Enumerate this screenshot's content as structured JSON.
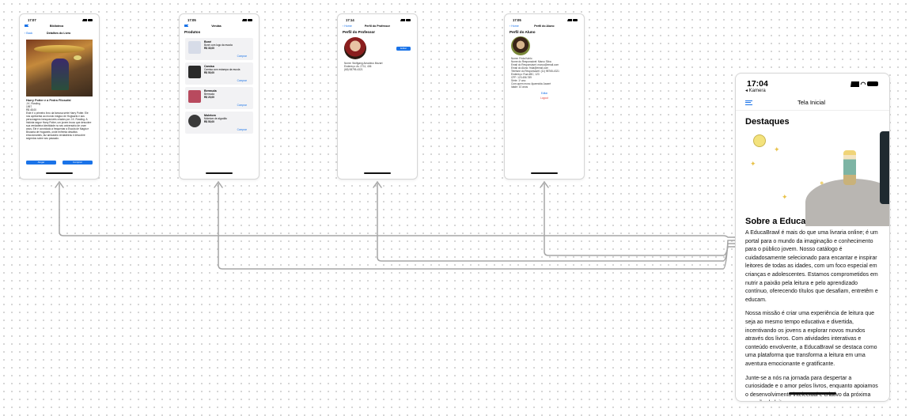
{
  "colors": {
    "accent": "#1a73e8",
    "connector": "#a6a6a6",
    "danger": "#e0403a"
  },
  "screens": [
    {
      "time": "17:07",
      "nav_title": "Biblioteca",
      "back_label": "Back",
      "subtitle": "Detalhes do Livro",
      "book_title": "Harry Potter e a Pedra Filosofal",
      "author": "J.K. Rowling",
      "year": "1997",
      "price": "R$ 45,00",
      "description": "Este é o primeiro livro da famosa série Harry Potter. Ele nos apresenta ao mundo mágico de Hogwarts e aos personagens inesquecíveis criados por J.K. Rowling. A história segue Harry Potter, um jovem bruxo que descobre sua verdadeira identidade no seu aniversário de onze anos. Ele é convidado a frequentar a Escola de Magia e Bruxaria de Hogwarts, onde enfrenta desafios emocionantes, faz amizades verdadeiras e descobre segredos sobre seu passado.",
      "btn_left": "Alugar",
      "btn_right": "Comprar"
    },
    {
      "time": "17:05",
      "nav_title": "Vendas",
      "heading": "Produtos",
      "products": [
        {
          "name": "Boné",
          "desc": "Boné com logo da escola",
          "price": "R$ 30,00",
          "buy": "Comprar",
          "color": "#d7dce8"
        },
        {
          "name": "Camisa",
          "desc": "Camisa com estampa da escola",
          "price": "R$ 50,00",
          "buy": "Comprar",
          "color": "#2a2a2a"
        },
        {
          "name": "Bermuda",
          "desc": "Bermuda",
          "price": "R$ 20,00",
          "buy": "Comprar",
          "color": "#b84a5e"
        },
        {
          "name": "Moletom",
          "desc": "Moletom de algodão",
          "price": "R$ 50,00",
          "buy": "Comprar",
          "color": "#3a3a3a"
        }
      ]
    },
    {
      "time": "17:14",
      "back_label": "Home",
      "nav_title": "Perfil do Professor",
      "heading": "Perfil do Professor",
      "button": "Editar",
      "details": [
        "Nome: Wolfgang Amadeus Mozart",
        "Endereço: Av. 2711, 406",
        "(68) 98795-4321"
      ]
    },
    {
      "time": "17:05",
      "back_label": "Home",
      "nav_title": "Perfil do Aluno",
      "heading": "Perfil do Aluno",
      "details": [
        "Nome: Frida Kahlo",
        "Nome do Responsável: Marco Silva",
        "Email do Responsável: marco@email.com",
        "Email do Aluno: frida@email.com",
        "Telefone do Responsável: (11) 98765-4321",
        "Endereço: Rua ABC, 123",
        "CPF: 123.456.789",
        "Série: 1º ano",
        "Com quem mora: Aparecida Jacaré",
        "Idade: 10 anos"
      ],
      "edit": "Editar",
      "logout": "Logout"
    }
  ],
  "main": {
    "time": "17:04",
    "back_app": "◂ Kamera",
    "nav_title": "Tela Inicial",
    "highlights_title": "Destaques",
    "about_title": "Sobre a EducaBrawl",
    "paragraphs": [
      "A EducaBrawl é mais do que uma livraria online; é um portal para o mundo da imaginação e conhecimento para o público jovem. Nosso catálogo é cuidadosamente selecionado para encantar e inspirar leitores de todas as idades, com um foco especial em crianças e adolescentes. Estamos comprometidos em nutrir a paixão pela leitura e pelo aprendizado contínuo, oferecendo títulos que desafiam, entretêm e educam.",
      "Nossa missão é criar uma experiência de leitura que seja ao mesmo tempo educativa e divertida, incentivando os jovens a explorar novos mundos através dos livros. Com atividades interativas e conteúdo envolvente, a EducaBrawl se destaca como uma plataforma que transforma a leitura em uma aventura emocionante e gratificante.",
      "Junte-se a nós na jornada para despertar a curiosidade e o amor pelos livros, enquanto apoiamos o desenvolvimento intelectual e criativo da próxima geração de leitores."
    ]
  }
}
